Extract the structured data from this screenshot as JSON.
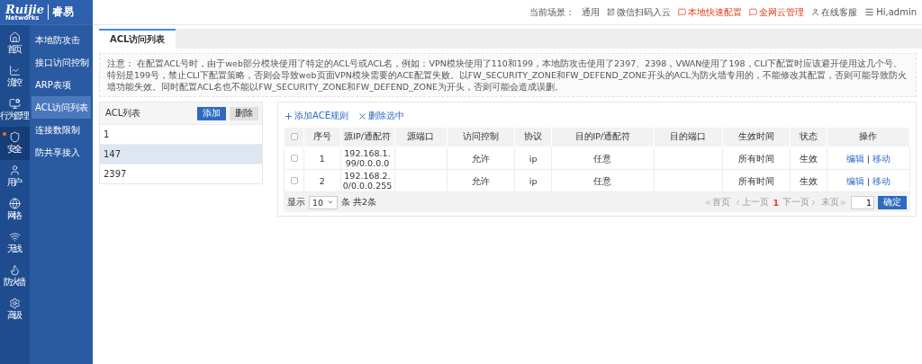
{
  "logo": {
    "brand": "Ruijie",
    "sub": "Networks",
    "product": "睿易"
  },
  "header": {
    "items": [
      {
        "kind": "text",
        "label": "当前场景：",
        "highlight": false
      },
      {
        "kind": "text",
        "label": "通用",
        "highlight": false
      },
      {
        "kind": "qr",
        "label": "微信扫码入云",
        "highlight": false
      },
      {
        "kind": "quick",
        "label": "本地快速配置",
        "highlight": true
      },
      {
        "kind": "quick",
        "label": "全网云管理",
        "highlight": true
      },
      {
        "kind": "user",
        "label": "在线客服",
        "highlight": false
      },
      {
        "kind": "menu",
        "label": "Hi,admin",
        "highlight": false
      }
    ]
  },
  "nav": [
    {
      "kind": "home",
      "label": "首页",
      "selected": false,
      "alert": false
    },
    {
      "kind": "chart",
      "label": "流控",
      "selected": false,
      "alert": false
    },
    {
      "kind": "behavior",
      "label": "行为管理",
      "selected": false,
      "alert": false
    },
    {
      "kind": "shield",
      "label": "安全",
      "selected": true,
      "alert": true
    },
    {
      "kind": "user",
      "label": "用户",
      "selected": false,
      "alert": false
    },
    {
      "kind": "network",
      "label": "网络",
      "selected": false,
      "alert": false
    },
    {
      "kind": "wifi",
      "label": "无线",
      "selected": false,
      "alert": false
    },
    {
      "kind": "firewall",
      "label": "防火墙",
      "selected": false,
      "alert": false
    },
    {
      "kind": "gear",
      "label": "高级",
      "selected": false,
      "alert": false
    }
  ],
  "submenu": [
    {
      "label": "本地防攻击",
      "selected": false
    },
    {
      "label": "接口访问控制",
      "selected": false
    },
    {
      "label": "ARP表项",
      "selected": false
    },
    {
      "label": "ACL访问列表",
      "selected": true
    },
    {
      "label": "连接数限制",
      "selected": false
    },
    {
      "label": "防共享接入",
      "selected": false
    }
  ],
  "tabs": [
    {
      "label": "ACL访问列表",
      "selected": true
    }
  ],
  "notice": {
    "title": "注意：",
    "text": "在配置ACL号时，由于web部分模块使用了特定的ACL号或ACL名，例如：VPN模块使用了110和199，本地防攻击使用了2397、2398，VWAN使用了198，CLI下配置时应该避开使用这几个号。特别是199号，禁止CLI下配置策略，否则会导致web页面VPN模块需要的ACE配置失败。以FW_SECURITY_ZONE和FW_DEFEND_ZONE开头的ACL为防火墙专用的，不能修改其配置，否则可能导致防火墙功能失效。同时配置ACL名也不能以FW_SECURITY_ZONE和FW_DEFEND_ZONE为开头，否则可能会造成误删。"
  },
  "acl_list": {
    "title": "ACL列表",
    "add": "添加",
    "delete": "删除",
    "items": [
      {
        "label": "1",
        "selected": false
      },
      {
        "label": "147",
        "selected": true
      },
      {
        "label": "2397",
        "selected": false
      }
    ]
  },
  "rules": {
    "add": "添加ACE规则",
    "delete": "删除选中",
    "action_separator": "|",
    "columns": [
      "序号",
      "源IP/通配符",
      "源端口",
      "访问控制",
      "协议",
      "目的IP/通配符",
      "目的端口",
      "生效时间",
      "状态",
      "操作"
    ],
    "header_checked": false,
    "rows": [
      {
        "checked": false,
        "cells": [
          "1",
          "192.168.1.99/0.0.0.0",
          "",
          "允许",
          "ip",
          "任意",
          "",
          "所有时间",
          "生效"
        ],
        "actions": [
          "编辑",
          "移动"
        ]
      },
      {
        "checked": false,
        "cells": [
          "2",
          "192.168.2.0/0.0.0.255",
          "",
          "允许",
          "ip",
          "任意",
          "",
          "所有时间",
          "生效"
        ],
        "actions": [
          "编辑",
          "移动"
        ]
      }
    ],
    "pager": {
      "show": "显示",
      "page_size": "10",
      "total": "条 共2条",
      "first": "首页",
      "prev": "上一页",
      "current": "1",
      "next": "下一页",
      "last": "末页",
      "page_input": "1",
      "go": "确定"
    }
  }
}
